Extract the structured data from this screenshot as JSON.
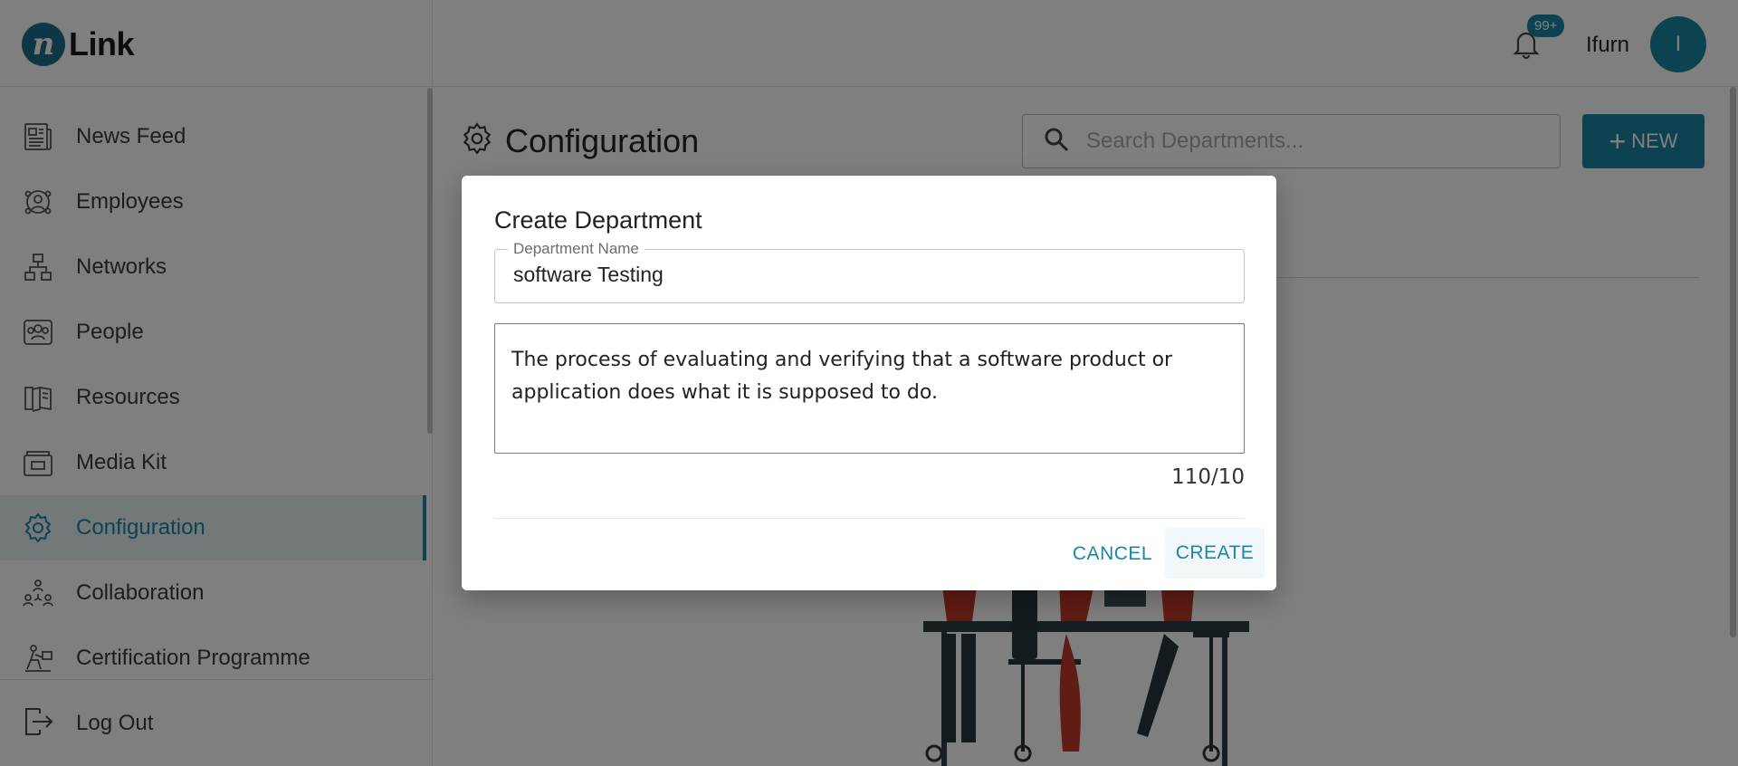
{
  "app": {
    "logo_mark": "n",
    "logo_text": "Link"
  },
  "sidebar": {
    "items": [
      {
        "label": "News Feed",
        "icon": "news-feed-icon"
      },
      {
        "label": "Employees",
        "icon": "employees-icon"
      },
      {
        "label": "Networks",
        "icon": "networks-icon"
      },
      {
        "label": "People",
        "icon": "people-icon"
      },
      {
        "label": "Resources",
        "icon": "resources-icon"
      },
      {
        "label": "Media Kit",
        "icon": "media-kit-icon"
      },
      {
        "label": "Configuration",
        "icon": "gear-icon",
        "active": true
      },
      {
        "label": "Collaboration",
        "icon": "collaboration-icon"
      },
      {
        "label": "Certification Programme",
        "icon": "certification-icon"
      }
    ],
    "logout_label": "Log Out"
  },
  "header": {
    "notification_count": "99+",
    "username": "Ifurn",
    "avatar_initial": "I"
  },
  "main": {
    "page_title": "Configuration",
    "search_placeholder": "Search Departments...",
    "new_button_label": "NEW"
  },
  "modal": {
    "title": "Create Department",
    "name_label": "Department Name",
    "name_value": "software Testing",
    "description_value": "The process of evaluating and verifying that a software product or application does what it is supposed to do.",
    "char_count": "110/10",
    "cancel_label": "CANCEL",
    "create_label": "CREATE"
  },
  "colors": {
    "accent": "#1b86a3",
    "overlay": "rgba(0,0,0,0.5)"
  }
}
